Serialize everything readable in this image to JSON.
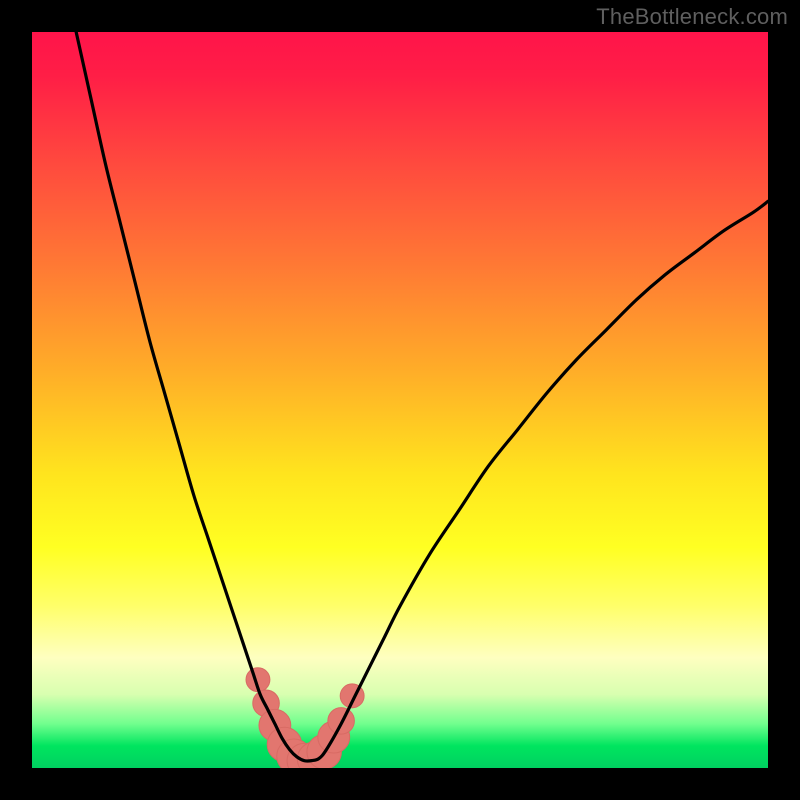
{
  "watermark": "TheBottleneck.com",
  "colors": {
    "background": "#000000",
    "curve": "#000000",
    "marker_fill": "#e2766f",
    "marker_stroke": "#d86b64",
    "gradient_top": "#ff144a",
    "gradient_bottom": "#00d060"
  },
  "chart_data": {
    "type": "line",
    "title": "",
    "xlabel": "",
    "ylabel": "",
    "xlim": [
      0,
      100
    ],
    "ylim": [
      0,
      100
    ],
    "grid": false,
    "legend": false,
    "series": [
      {
        "name": "bottleneck-curve",
        "x": [
          6,
          8,
          10,
          12,
          14,
          16,
          18,
          20,
          22,
          24,
          26,
          28,
          30,
          31,
          32,
          33,
          34,
          35,
          36,
          37,
          38,
          39,
          40,
          42,
          44,
          46,
          48,
          50,
          54,
          58,
          62,
          66,
          70,
          74,
          78,
          82,
          86,
          90,
          94,
          98,
          100
        ],
        "y": [
          100,
          91,
          82,
          74,
          66,
          58,
          51,
          44,
          37,
          31,
          25,
          19,
          13,
          10,
          8,
          6,
          4,
          2.5,
          1.5,
          1,
          1,
          1.3,
          2.5,
          6,
          10,
          14,
          18,
          22,
          29,
          35,
          41,
          46,
          51,
          55.5,
          59.5,
          63.5,
          67,
          70,
          73,
          75.5,
          77
        ]
      }
    ],
    "markers": {
      "name": "highlight-band",
      "points": [
        {
          "x": 30.7,
          "y": 12.0,
          "r": 1.2
        },
        {
          "x": 31.8,
          "y": 8.8,
          "r": 1.4
        },
        {
          "x": 33.0,
          "y": 5.8,
          "r": 1.8
        },
        {
          "x": 34.3,
          "y": 3.2,
          "r": 2.0
        },
        {
          "x": 35.6,
          "y": 1.6,
          "r": 2.0
        },
        {
          "x": 37.0,
          "y": 1.0,
          "r": 2.0
        },
        {
          "x": 38.4,
          "y": 1.2,
          "r": 2.0
        },
        {
          "x": 39.7,
          "y": 2.2,
          "r": 2.0
        },
        {
          "x": 41.0,
          "y": 4.2,
          "r": 1.8
        },
        {
          "x": 42.0,
          "y": 6.4,
          "r": 1.4
        },
        {
          "x": 43.5,
          "y": 9.8,
          "r": 1.2
        }
      ]
    }
  }
}
